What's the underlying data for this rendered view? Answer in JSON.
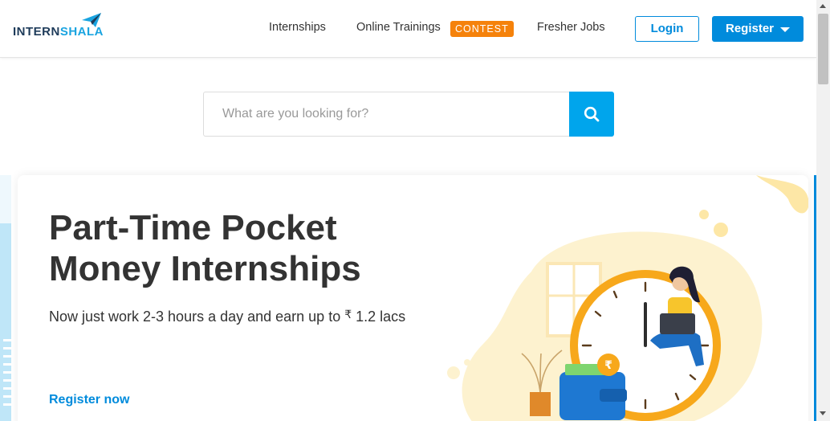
{
  "header": {
    "logo": {
      "part1": "INTERN",
      "part2": "SHALA"
    },
    "nav": [
      {
        "label": "Internships"
      },
      {
        "label": "Online Trainings",
        "badge": "CONTEST"
      },
      {
        "label": "Fresher Jobs"
      }
    ],
    "login_label": "Login",
    "register_label": "Register"
  },
  "search": {
    "placeholder": "What are you looking for?",
    "icon": "search-icon"
  },
  "hero": {
    "title_line1": "Part-Time Pocket",
    "title_line2": "Money Internships",
    "subtitle": "Now just work 2-3 hours a day and earn up to ",
    "currency": "₹",
    "amount": " 1.2 lacs",
    "cta": "Register now"
  },
  "colors": {
    "brand_blue": "#008bdc",
    "search_blue": "#00a5ec",
    "badge_orange": "#f5820b",
    "text_dark": "#333333"
  }
}
